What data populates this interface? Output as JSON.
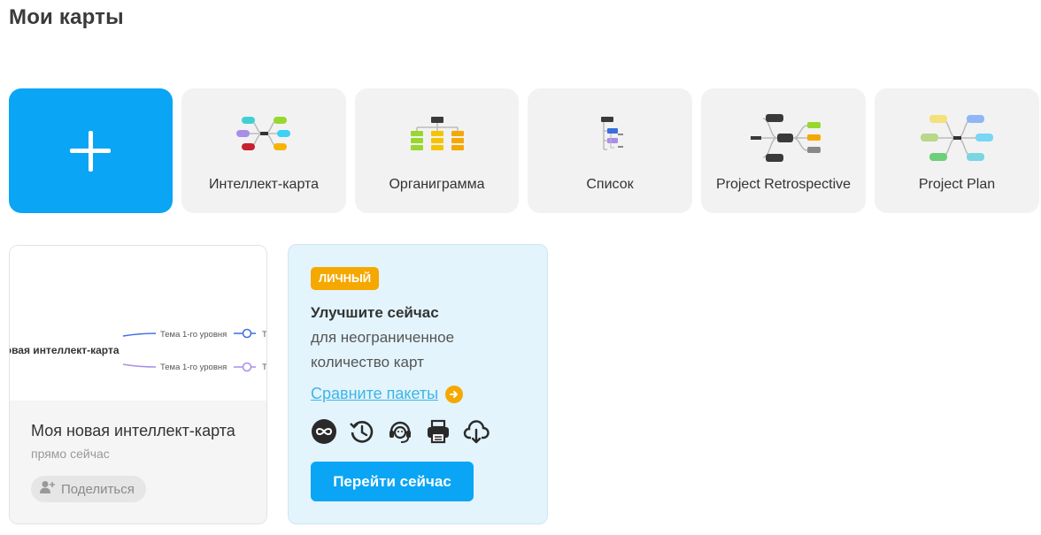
{
  "page": {
    "title": "Мои карты"
  },
  "templates": [
    {
      "label": "",
      "icon": "plus-icon"
    },
    {
      "label": "Интеллект-карта",
      "icon": "mind-map-icon"
    },
    {
      "label": "Органиграмма",
      "icon": "org-chart-icon"
    },
    {
      "label": "Список",
      "icon": "list-icon"
    },
    {
      "label": "Project Retrospective",
      "icon": "retrospective-icon"
    },
    {
      "label": "Project Plan",
      "icon": "project-plan-icon"
    }
  ],
  "map_card": {
    "preview": {
      "central_topic": "Моя новая интеллект-карта",
      "branch_1": "Тема 1-го уровня",
      "branch_2": "Тема 1-го уровня",
      "sub_letter_1": "Т",
      "sub_letter_2": "Т"
    },
    "name": "Моя новая интеллект-карта",
    "time": "прямо сейчас",
    "share_label": "Поделиться"
  },
  "upsell": {
    "badge": "ЛИЧНЫЙ",
    "title": "Улучшите сейчас",
    "line1": "для неограниченное",
    "line2": "количество карт",
    "compare_link": "Сравните пакеты",
    "features": [
      "infinity-icon",
      "history-icon",
      "support-icon",
      "print-icon",
      "download-icon"
    ],
    "cta": "Перейти сейчас"
  },
  "colors": {
    "accent": "#0aa5f5",
    "badge": "#f5a800",
    "link": "#3db5e6"
  }
}
